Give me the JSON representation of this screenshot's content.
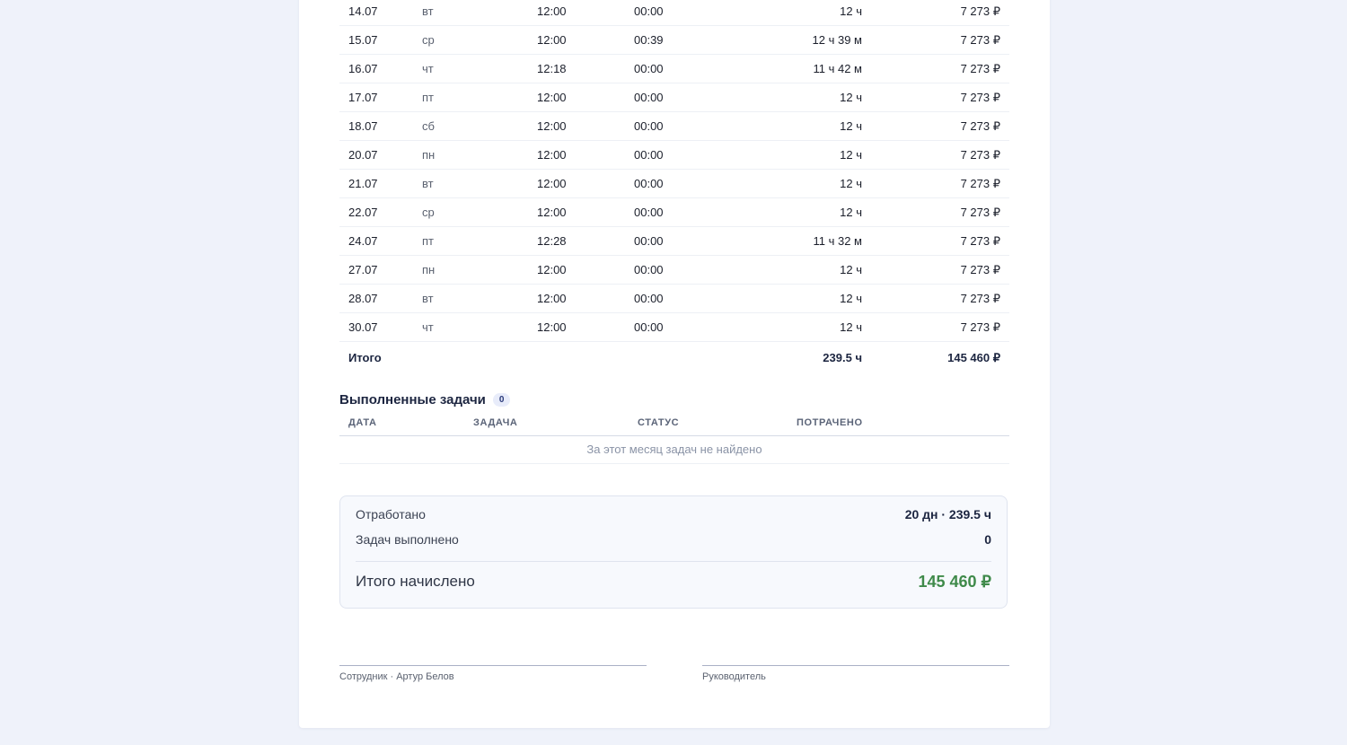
{
  "attendance": {
    "rows": [
      {
        "date": "14.07",
        "dow": "вт",
        "start": "12:00",
        "end": "00:00",
        "hours": "12 ч",
        "pay": "7 273 ₽"
      },
      {
        "date": "15.07",
        "dow": "ср",
        "start": "12:00",
        "end": "00:39",
        "hours": "12 ч 39 м",
        "pay": "7 273 ₽"
      },
      {
        "date": "16.07",
        "dow": "чт",
        "start": "12:18",
        "end": "00:00",
        "hours": "11 ч 42 м",
        "pay": "7 273 ₽"
      },
      {
        "date": "17.07",
        "dow": "пт",
        "start": "12:00",
        "end": "00:00",
        "hours": "12 ч",
        "pay": "7 273 ₽"
      },
      {
        "date": "18.07",
        "dow": "сб",
        "start": "12:00",
        "end": "00:00",
        "hours": "12 ч",
        "pay": "7 273 ₽"
      },
      {
        "date": "20.07",
        "dow": "пн",
        "start": "12:00",
        "end": "00:00",
        "hours": "12 ч",
        "pay": "7 273 ₽"
      },
      {
        "date": "21.07",
        "dow": "вт",
        "start": "12:00",
        "end": "00:00",
        "hours": "12 ч",
        "pay": "7 273 ₽"
      },
      {
        "date": "22.07",
        "dow": "ср",
        "start": "12:00",
        "end": "00:00",
        "hours": "12 ч",
        "pay": "7 273 ₽"
      },
      {
        "date": "24.07",
        "dow": "пт",
        "start": "12:28",
        "end": "00:00",
        "hours": "11 ч 32 м",
        "pay": "7 273 ₽"
      },
      {
        "date": "27.07",
        "dow": "пн",
        "start": "12:00",
        "end": "00:00",
        "hours": "12 ч",
        "pay": "7 273 ₽"
      },
      {
        "date": "28.07",
        "dow": "вт",
        "start": "12:00",
        "end": "00:00",
        "hours": "12 ч",
        "pay": "7 273 ₽"
      },
      {
        "date": "30.07",
        "dow": "чт",
        "start": "12:00",
        "end": "00:00",
        "hours": "12 ч",
        "pay": "7 273 ₽"
      }
    ],
    "total": {
      "label": "Итого",
      "hours": "239.5 ч",
      "pay": "145 460 ₽"
    }
  },
  "tasks": {
    "title": "Выполненные задачи",
    "count": "0",
    "columns": [
      "ДАТА",
      "ЗАДАЧА",
      "СТАТУС",
      "ПОТРАЧЕНО"
    ],
    "empty_text": "За этот месяц задач не найдено"
  },
  "summary": {
    "worked_label": "Отработано",
    "worked_value": "20 дн · 239.5 ч",
    "tasks_label": "Задач выполнено",
    "tasks_value": "0",
    "total_label": "Итого начислено",
    "total_value": "145 460 ₽"
  },
  "signatures": {
    "employee": "Сотрудник · Артур Белов",
    "manager": "Руководитель"
  },
  "colors": {
    "accent_green": "#3f8a4a",
    "heading_navy": "#1c2540",
    "page_bg": "#eff2fa"
  }
}
